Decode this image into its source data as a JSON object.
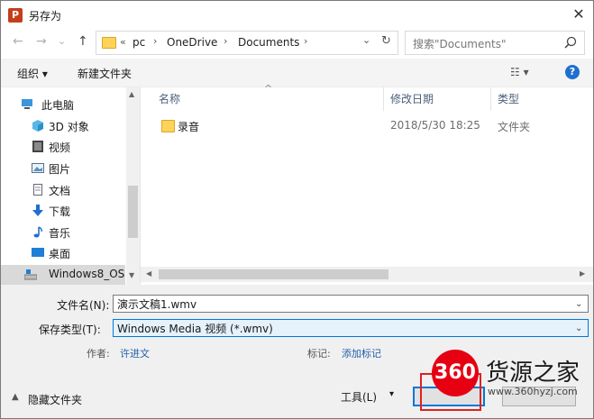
{
  "window": {
    "title": "另存为",
    "app_icon_letter": "P",
    "close_glyph": "✕"
  },
  "nav_buttons": {
    "back": "←",
    "forward": "→",
    "dropdown": "⌄",
    "up": "↑"
  },
  "address_bar": {
    "overflow": "«",
    "crumbs": [
      "pc",
      "OneDrive",
      "Documents"
    ],
    "separator": "›",
    "dropdown": "⌄",
    "refresh": "↻"
  },
  "search": {
    "placeholder": "搜索\"Documents\"",
    "icon": "search-icon"
  },
  "toolbar": {
    "organize": "组织 ▾",
    "new_folder": "新建文件夹",
    "view": "☷ ▾",
    "help": "?"
  },
  "sidebar": {
    "items": [
      {
        "label": "此电脑",
        "icon": "computer-icon"
      },
      {
        "label": "3D 对象",
        "icon": "cube-icon"
      },
      {
        "label": "视频",
        "icon": "video-icon"
      },
      {
        "label": "图片",
        "icon": "picture-icon"
      },
      {
        "label": "文档",
        "icon": "document-icon"
      },
      {
        "label": "下载",
        "icon": "download-icon"
      },
      {
        "label": "音乐",
        "icon": "music-icon"
      },
      {
        "label": "桌面",
        "icon": "desktop-icon"
      },
      {
        "label": "Windows8_OS",
        "icon": "drive-icon"
      }
    ]
  },
  "columns": {
    "name": "名称",
    "modified": "修改日期",
    "type": "类型",
    "sort_indicator": "^"
  },
  "files": [
    {
      "name": "录音",
      "modified": "2018/5/30 18:25",
      "type": "文件夹"
    }
  ],
  "form": {
    "filename_label": "文件名(N):",
    "filename_value": "演示文稿1.wmv",
    "filetype_label": "保存类型(T):",
    "filetype_value": "Windows Media 视频 (*.wmv)",
    "author_label": "作者:",
    "author_value": "许进文",
    "tags_label": "标记:",
    "tags_value": "添加标记",
    "hide_folders": "隐藏文件夹",
    "tools": "工具(L)",
    "tools_arrow": "▾"
  },
  "watermark": {
    "logo": "360",
    "name": "货源之家",
    "url": "www.360hyzj.com"
  }
}
